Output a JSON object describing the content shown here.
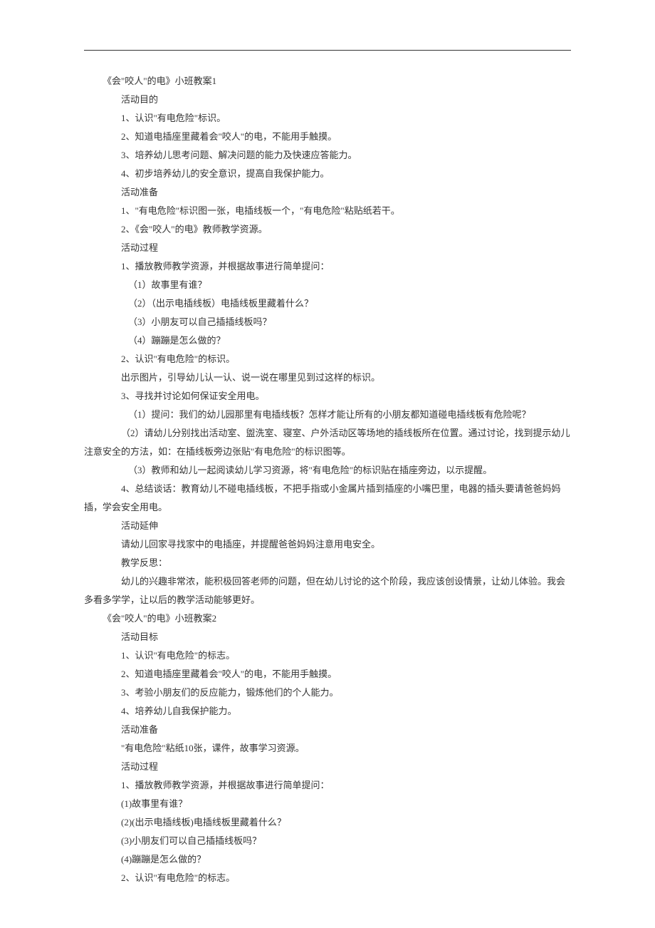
{
  "plan1": {
    "title": "《会\"咬人\"的电》小班教案1",
    "s_goals_h": "活动目的",
    "g1": "1、认识\"有电危险\"标识。",
    "g2": "2、知道电插座里藏着会\"咬人\"的电，不能用手触摸。",
    "g3": "3、培养幼儿思考问题、解决问题的能力及快速应答能力。",
    "g4": "4、初步培养幼儿的安全意识，提高自我保护能力。",
    "s_prep_h": "活动准备",
    "p1": "1、\"有电危险\"标识图一张，电插线板一个，\"有电危险\"粘贴纸若干。",
    "p2": "2、《会\"咬人\"的电》教师教学资源。",
    "s_proc_h": "活动过程",
    "pr1": "1、播放教师教学资源，并根据故事进行简单提问：",
    "pr1_1": "（1）故事里有谁？",
    "pr1_2": "（2）（出示电插线板）电插线板里藏着什么？",
    "pr1_3": "（3）小朋友可以自己插插线板吗？",
    "pr1_4": "（4）蹦蹦是怎么做的？",
    "pr2": "2、认识\"有电危险\"的标识。",
    "pr2_1": "出示图片，引导幼儿认一认、说一说在哪里见到过这样的标识。",
    "pr3": "3、寻找并讨论如何保证安全用电。",
    "pr3_1": "（1）提问：我们的幼儿园那里有电插线板？怎样才能让所有的小朋友都知道碰电插线板有危险呢？",
    "pr3_2": "（2）请幼儿分别找出活动室、盥洗室、寝室、户外活动区等场地的插线板所在位置。通过讨论，找到提示幼儿注意安全的方法，如：在插线板旁边张贴\"有电危险\"的标识图等。",
    "pr3_3": "（3）教师和幼儿一起阅读幼儿学习资源，将\"有电危险\"的标识贴在插座旁边，以示提醒。",
    "pr4": "4、总结谈话：教育幼儿不碰电插线板，不把手指或小金属片插到插座的小嘴巴里，电器的插头要请爸爸妈妈插，学会安全用电。",
    "s_ext_h": "活动延伸",
    "ext1": "请幼儿回家寻找家中的电插座，并提醒爸爸妈妈注意用电安全。",
    "s_ref_h": "教学反思：",
    "ref1": "幼儿的兴趣非常浓，能积极回答老师的问题，但在幼儿讨论的这个阶段，我应该创设情景，让幼儿体验。我会多看多学学，让以后的教学活动能够更好。"
  },
  "plan2": {
    "title": "《会\"咬人\"的电》小班教案2",
    "s_goals_h": "活动目标",
    "g1": "1、认识\"有电危险\"的标志。",
    "g2": "2、知道电插座里藏着会\"咬人\"的电，不能用手触摸。",
    "g3": "3、考验小朋友们的反应能力，锻炼他们的个人能力。",
    "g4": "4、培养幼儿自我保护能力。",
    "s_prep_h": "活动准备",
    "p1": "\"有电危险\"粘纸10张，课件，故事学习资源。",
    "s_proc_h": "活动过程",
    "pr1": "1、播放教师教学资源，并根据故事进行简单提问：",
    "pr1_1": "(1)故事里有谁？",
    "pr1_2": "(2)(出示电插线板)电插线板里藏着什么？",
    "pr1_3": "(3)小朋友们可以自己插插线板吗？",
    "pr1_4": "(4)蹦蹦是怎么做的？",
    "pr2": "2、认识\"有电危险\"的标志。"
  }
}
